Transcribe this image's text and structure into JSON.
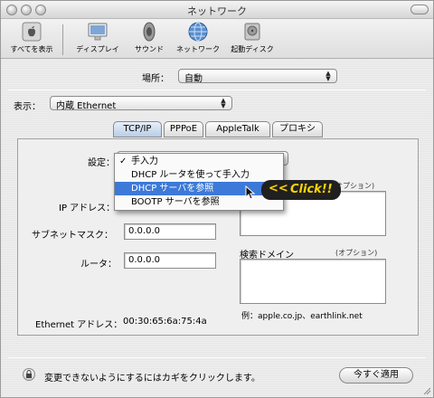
{
  "window": {
    "title": "ネットワーク"
  },
  "toolbar": {
    "items": [
      {
        "label": "すべてを表示",
        "icon": "apple-icon"
      },
      {
        "label": "ディスプレイ",
        "icon": "display-icon"
      },
      {
        "label": "サウンド",
        "icon": "speaker-icon"
      },
      {
        "label": "ネットワーク",
        "icon": "network-globe-icon"
      },
      {
        "label": "起動ディスク",
        "icon": "startup-disk-icon"
      }
    ]
  },
  "location": {
    "label": "場所：",
    "value": "自動"
  },
  "show": {
    "label": "表示：",
    "value": "内蔵 Ethernet"
  },
  "tabs": [
    "TCP/IP",
    "PPPoE",
    "AppleTalk",
    "プロキシ"
  ],
  "active_tab": "TCP/IP",
  "tcpip": {
    "config_label": "設定：",
    "menu": {
      "options": [
        "手入力",
        "DHCP ルータを使って手入力",
        "DHCP サーバを参照",
        "BOOTP サーバを参照"
      ],
      "checked": "手入力",
      "highlighted": "DHCP サーバを参照"
    },
    "callout": "Click!!",
    "ip_label": "IP アドレス：",
    "subnet_label": "サブネットマスク：",
    "subnet_value": "0.0.0.0",
    "router_label": "ルータ：",
    "router_value": "0.0.0.0",
    "dns_option": "オプション)",
    "search_domain_label": "検索ドメイン",
    "search_domain_option": "(オプション)",
    "example": "例：apple.co.jp、earthlink.net",
    "ethernet_label": "Ethernet アドレス：",
    "ethernet_value": "00:30:65:6a:75:4a"
  },
  "footer": {
    "lock_text": "変更できないようにするにはカギをクリックします。",
    "apply_button": "今すぐ適用"
  }
}
